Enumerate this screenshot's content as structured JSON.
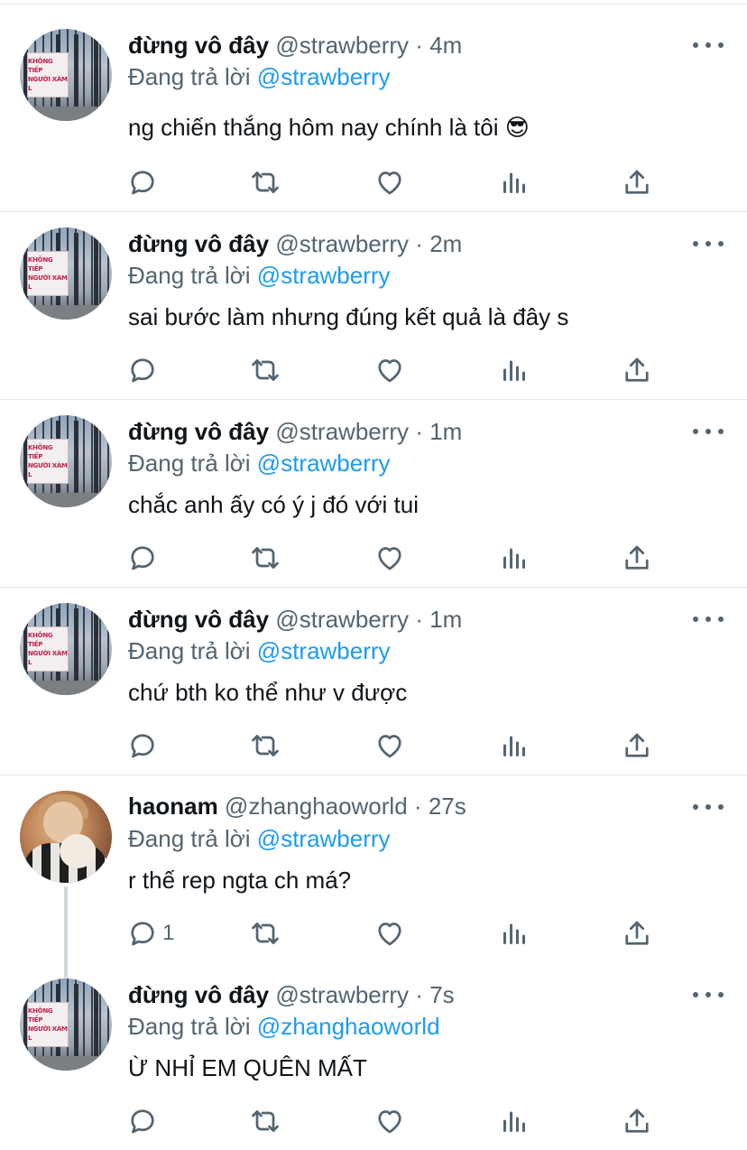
{
  "colors": {
    "accent": "#1d9bf0",
    "secondary_text": "#536471",
    "primary_text": "#0f1419",
    "divider": "#e6e9ec"
  },
  "tweets": [
    {
      "author_name": "đừng vô đây",
      "handle": "@strawberry",
      "separator": "·",
      "time": "4m",
      "reply_prefix": "Đang trả lời",
      "reply_to": "@strawberry",
      "text": "ng chiến thắng hôm nay chính là tôi 😎",
      "reply_count": "",
      "avatar_icon": "gate-sign-avatar",
      "avatar_sign_text": [
        "KHÔNG TIẾP",
        "NGƯỜI XÀM L"
      ]
    },
    {
      "author_name": "đừng vô đây",
      "handle": "@strawberry",
      "separator": "·",
      "time": "2m",
      "reply_prefix": "Đang trả lời",
      "reply_to": "@strawberry",
      "text": "sai bước làm nhưng đúng kết quả là đây s",
      "reply_count": "",
      "avatar_icon": "gate-sign-avatar",
      "avatar_sign_text": [
        "KHÔNG TIẾP",
        "NGƯỜI XÀM L"
      ]
    },
    {
      "author_name": "đừng vô đây",
      "handle": "@strawberry",
      "separator": "·",
      "time": "1m",
      "reply_prefix": "Đang trả lời",
      "reply_to": "@strawberry",
      "text": "chắc anh ấy có ý j đó với tui",
      "reply_count": "",
      "avatar_icon": "gate-sign-avatar",
      "avatar_sign_text": [
        "KHÔNG TIẾP",
        "NGƯỜI XÀM L"
      ]
    },
    {
      "author_name": "đừng vô đây",
      "handle": "@strawberry",
      "separator": "·",
      "time": "1m",
      "reply_prefix": "Đang trả lời",
      "reply_to": "@strawberry",
      "text": "chứ bth ko thể như v được",
      "reply_count": "",
      "avatar_icon": "gate-sign-avatar",
      "avatar_sign_text": [
        "KHÔNG TIẾP",
        "NGƯỜI XÀM L"
      ]
    },
    {
      "author_name": "haonam",
      "handle": "@zhanghaoworld",
      "separator": "·",
      "time": "27s",
      "reply_prefix": "Đang trả lời",
      "reply_to": "@strawberry",
      "text": "r thế rep ngta ch má?",
      "reply_count": "1",
      "avatar_icon": "person-avatar"
    },
    {
      "author_name": "đừng vô đây",
      "handle": "@strawberry",
      "separator": "·",
      "time": "7s",
      "reply_prefix": "Đang trả lời",
      "reply_to": "@zhanghaoworld",
      "text": "Ừ NHỈ EM QUÊN MẤT",
      "reply_count": "",
      "avatar_icon": "gate-sign-avatar",
      "avatar_sign_text": [
        "KHÔNG TIẾP",
        "NGƯỜI XÀM L"
      ]
    }
  ],
  "action_icons": [
    "reply-icon",
    "retweet-icon",
    "like-icon",
    "analytics-icon",
    "share-icon"
  ],
  "more_icon": "more-options-icon"
}
